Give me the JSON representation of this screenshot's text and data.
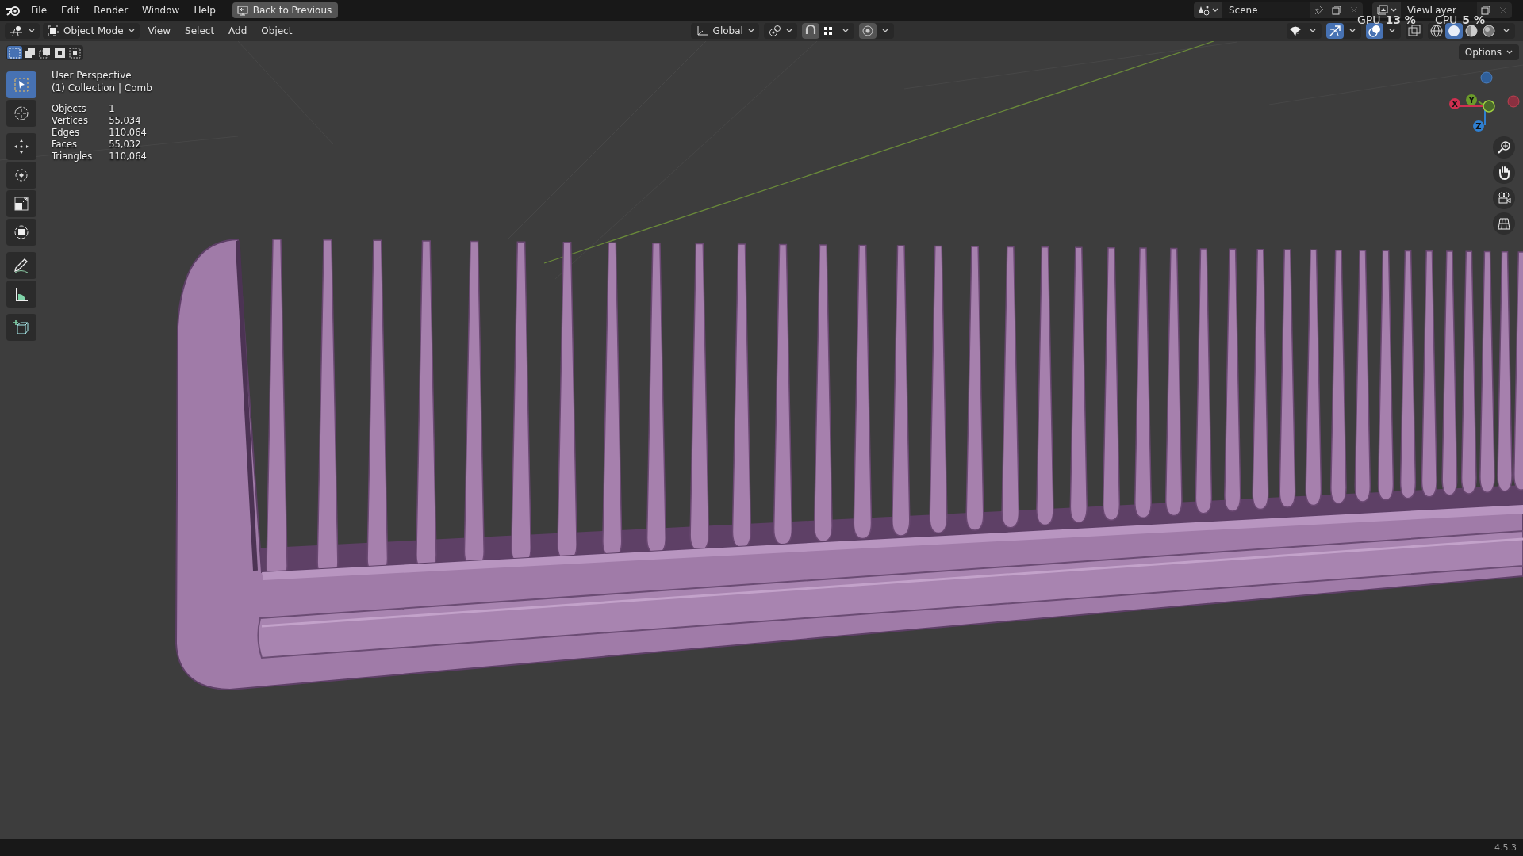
{
  "topbar": {
    "menus": [
      "File",
      "Edit",
      "Render",
      "Window",
      "Help"
    ],
    "back_button": "Back to Previous",
    "scene": "Scene",
    "view_layer": "ViewLayer"
  },
  "resource_monitor": [
    {
      "label": "GPU",
      "value": "13 %"
    },
    {
      "label": "CPU",
      "value": "5 %"
    }
  ],
  "header": {
    "mode": "Object Mode",
    "menus": [
      "View",
      "Select",
      "Add",
      "Object"
    ],
    "orientation": "Global",
    "toggles": [
      {
        "kind": "snap",
        "on": false
      },
      {
        "kind": "proportional",
        "on": false
      },
      {
        "kind": "gizmo",
        "on": true
      },
      {
        "kind": "overlay",
        "on": true
      },
      {
        "kind": "xray",
        "on": false
      }
    ],
    "shading": [
      {
        "kind": "wireframe",
        "selected": false
      },
      {
        "kind": "solid",
        "selected": true
      },
      {
        "kind": "material",
        "selected": false
      },
      {
        "kind": "rendered",
        "selected": false
      }
    ]
  },
  "select_modes": [
    {
      "kind": "new",
      "selected": true
    },
    {
      "kind": "extend",
      "selected": false
    },
    {
      "kind": "subtract",
      "selected": false
    },
    {
      "kind": "invert",
      "selected": false
    },
    {
      "kind": "intersect",
      "selected": false
    }
  ],
  "options_button": "Options",
  "tools": [
    {
      "kind": "select-box",
      "selected": true
    },
    {
      "kind": "cursor",
      "selected": false
    },
    {
      "kind": "move",
      "selected": false
    },
    {
      "kind": "rotate",
      "selected": false
    },
    {
      "kind": "scale",
      "selected": false
    },
    {
      "kind": "transform",
      "selected": false
    },
    {
      "kind": "annotate",
      "selected": false
    },
    {
      "kind": "measure",
      "selected": false
    },
    {
      "kind": "add-cube",
      "selected": false
    }
  ],
  "viewport": {
    "view_name": "User Perspective",
    "collection": "(1) Collection | Comb",
    "stats": [
      {
        "label": "Objects",
        "value": "1"
      },
      {
        "label": "Vertices",
        "value": "55,034"
      },
      {
        "label": "Edges",
        "value": "110,064"
      },
      {
        "label": "Faces",
        "value": "55,032"
      },
      {
        "label": "Triangles",
        "value": "110,064"
      }
    ]
  },
  "gizmo_axes": [
    "X",
    "Y",
    "Z"
  ],
  "nav_buttons": [
    {
      "kind": "zoom"
    },
    {
      "kind": "pan"
    },
    {
      "kind": "camera"
    },
    {
      "kind": "ortho"
    }
  ],
  "status_bar": {
    "version": "4.5.3"
  }
}
